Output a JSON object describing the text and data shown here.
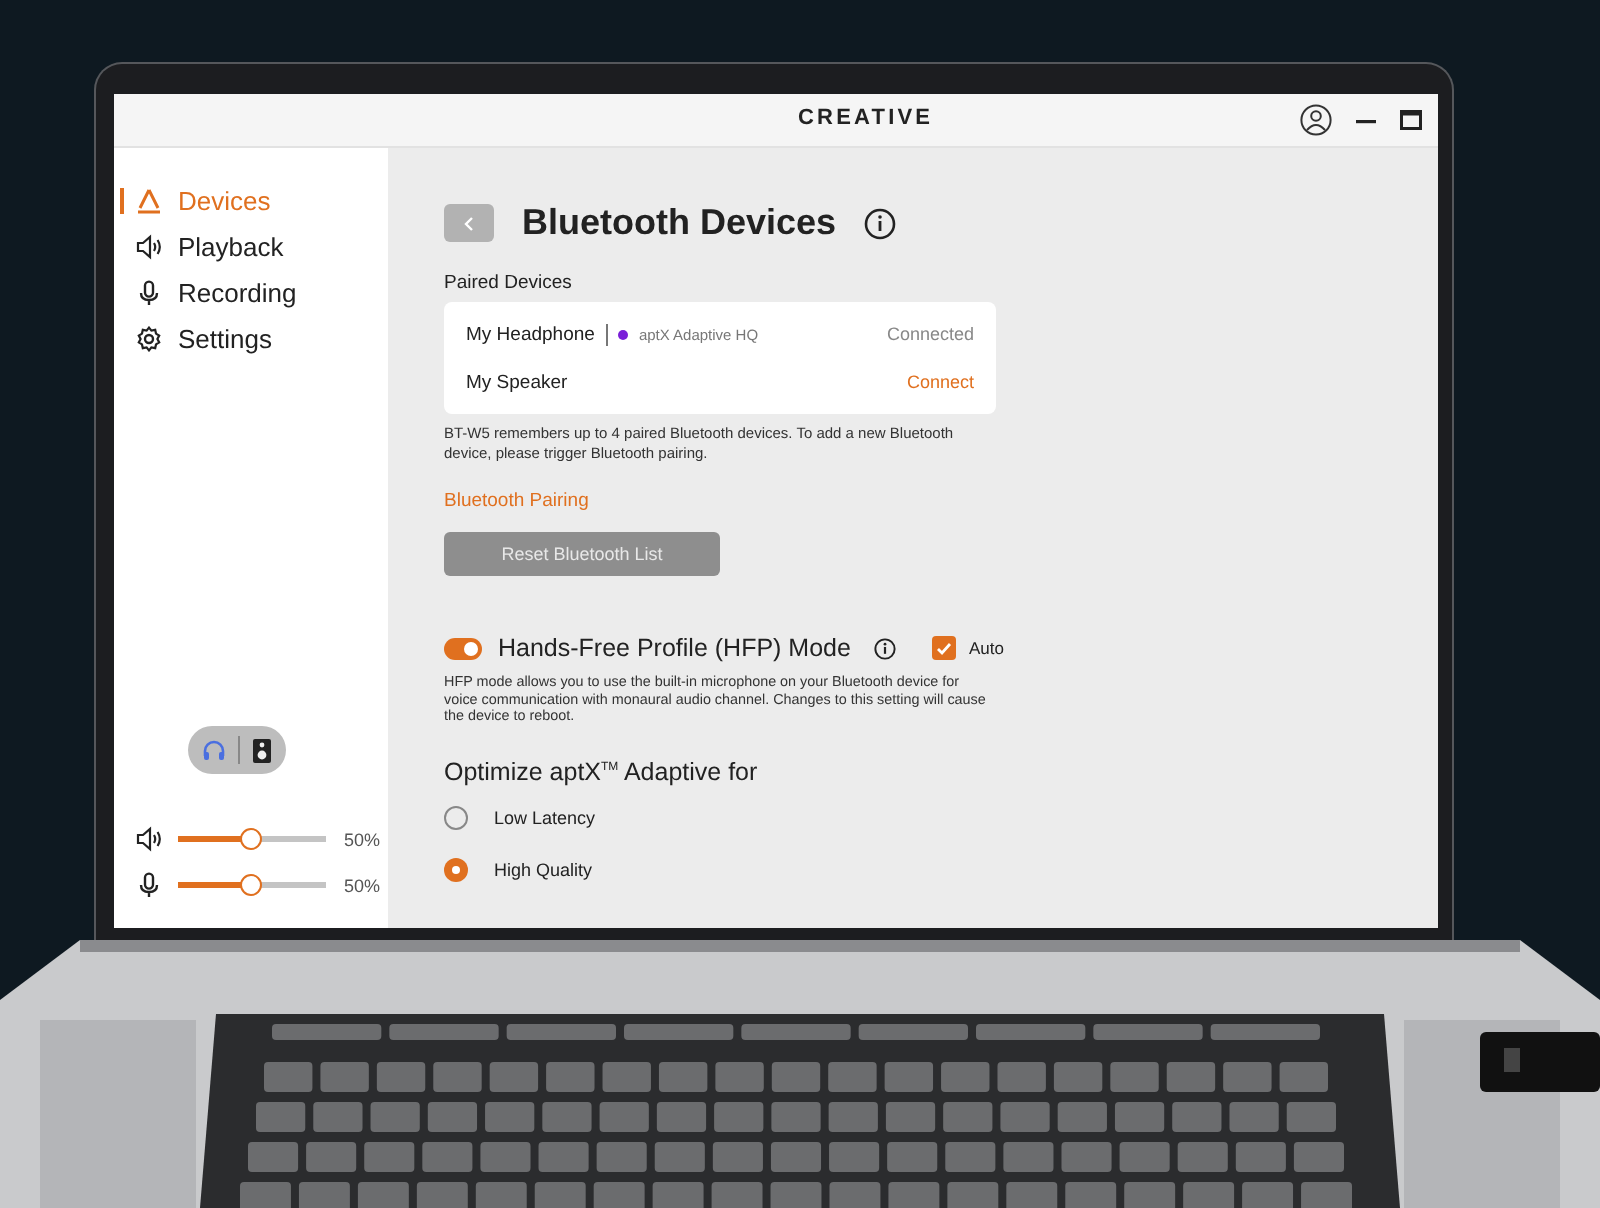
{
  "header": {
    "logo": "CREATIVE"
  },
  "sidebar": {
    "items": [
      {
        "label": "Devices",
        "kind": "devices",
        "selected": true
      },
      {
        "label": "Playback",
        "kind": "playback",
        "selected": false
      },
      {
        "label": "Recording",
        "kind": "recording",
        "selected": false
      },
      {
        "label": "Settings",
        "kind": "settings",
        "selected": false
      }
    ],
    "output_switch": [
      {
        "kind": "headphone",
        "selected": true
      },
      {
        "kind": "speaker",
        "selected": false
      }
    ],
    "sliders": [
      {
        "kind": "volume",
        "level": 0.5,
        "reading": "50%"
      },
      {
        "kind": "mic",
        "level": 0.5,
        "reading": "50%"
      }
    ]
  },
  "page": {
    "title": "Bluetooth Devices",
    "paired_label": "Paired Devices",
    "devices": [
      {
        "name": "My Headphone",
        "codec": "aptX Adaptive HQ",
        "color": "#7a1fd8",
        "status": "Connected",
        "connected": true
      },
      {
        "name": "My Speaker",
        "status": "Connect",
        "connected": false
      }
    ],
    "note": "BT-W5 remembers up to 4 paired Bluetooth devices. To add a new Bluetooth device, please trigger Bluetooth pairing.",
    "pairing_link": "Bluetooth Pairing",
    "reset_button": {
      "label": "Reset Bluetooth List",
      "disabled": true
    },
    "hfp": {
      "label": "Hands-Free Profile (HFP) Mode",
      "on": true,
      "auto": {
        "label": "Auto",
        "checked": true
      },
      "description": "HFP mode allows you to use the built-in microphone on your Bluetooth device for voice communication with monaural audio channel. Changes to this setting will cause the device to reboot."
    },
    "optimize": {
      "title": "Optimize aptX$^{TM}$ Adaptive for",
      "options": [
        {
          "label": "Low Latency",
          "selected": false
        },
        {
          "label": "High Quality",
          "selected": true
        }
      ]
    }
  }
}
